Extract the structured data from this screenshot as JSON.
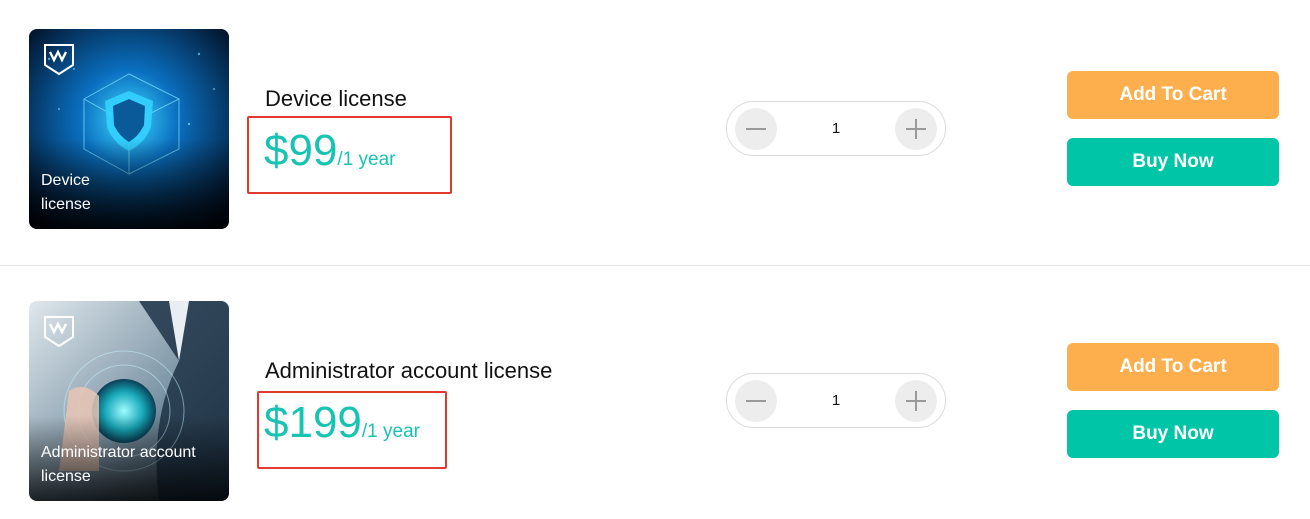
{
  "colors": {
    "price": "#17c3b2",
    "add_to_cart": "#fdaf4e",
    "buy_now": "#00c5a7",
    "highlight_box": "#e23a2f"
  },
  "products": [
    {
      "thumbnail_caption": "Device\nlicense",
      "thumbnail_icon": "shield-icon",
      "title": "Device license",
      "price": "$99",
      "period": "/1 year",
      "quantity": "1",
      "add_to_cart_label": "Add To Cart",
      "buy_now_label": "Buy Now"
    },
    {
      "thumbnail_caption": "Administrator account\nlicense",
      "thumbnail_icon": "globe-icon",
      "title": "Administrator account license",
      "price": "$199",
      "period": "/1 year",
      "quantity": "1",
      "add_to_cart_label": "Add To Cart",
      "buy_now_label": "Buy Now"
    }
  ]
}
